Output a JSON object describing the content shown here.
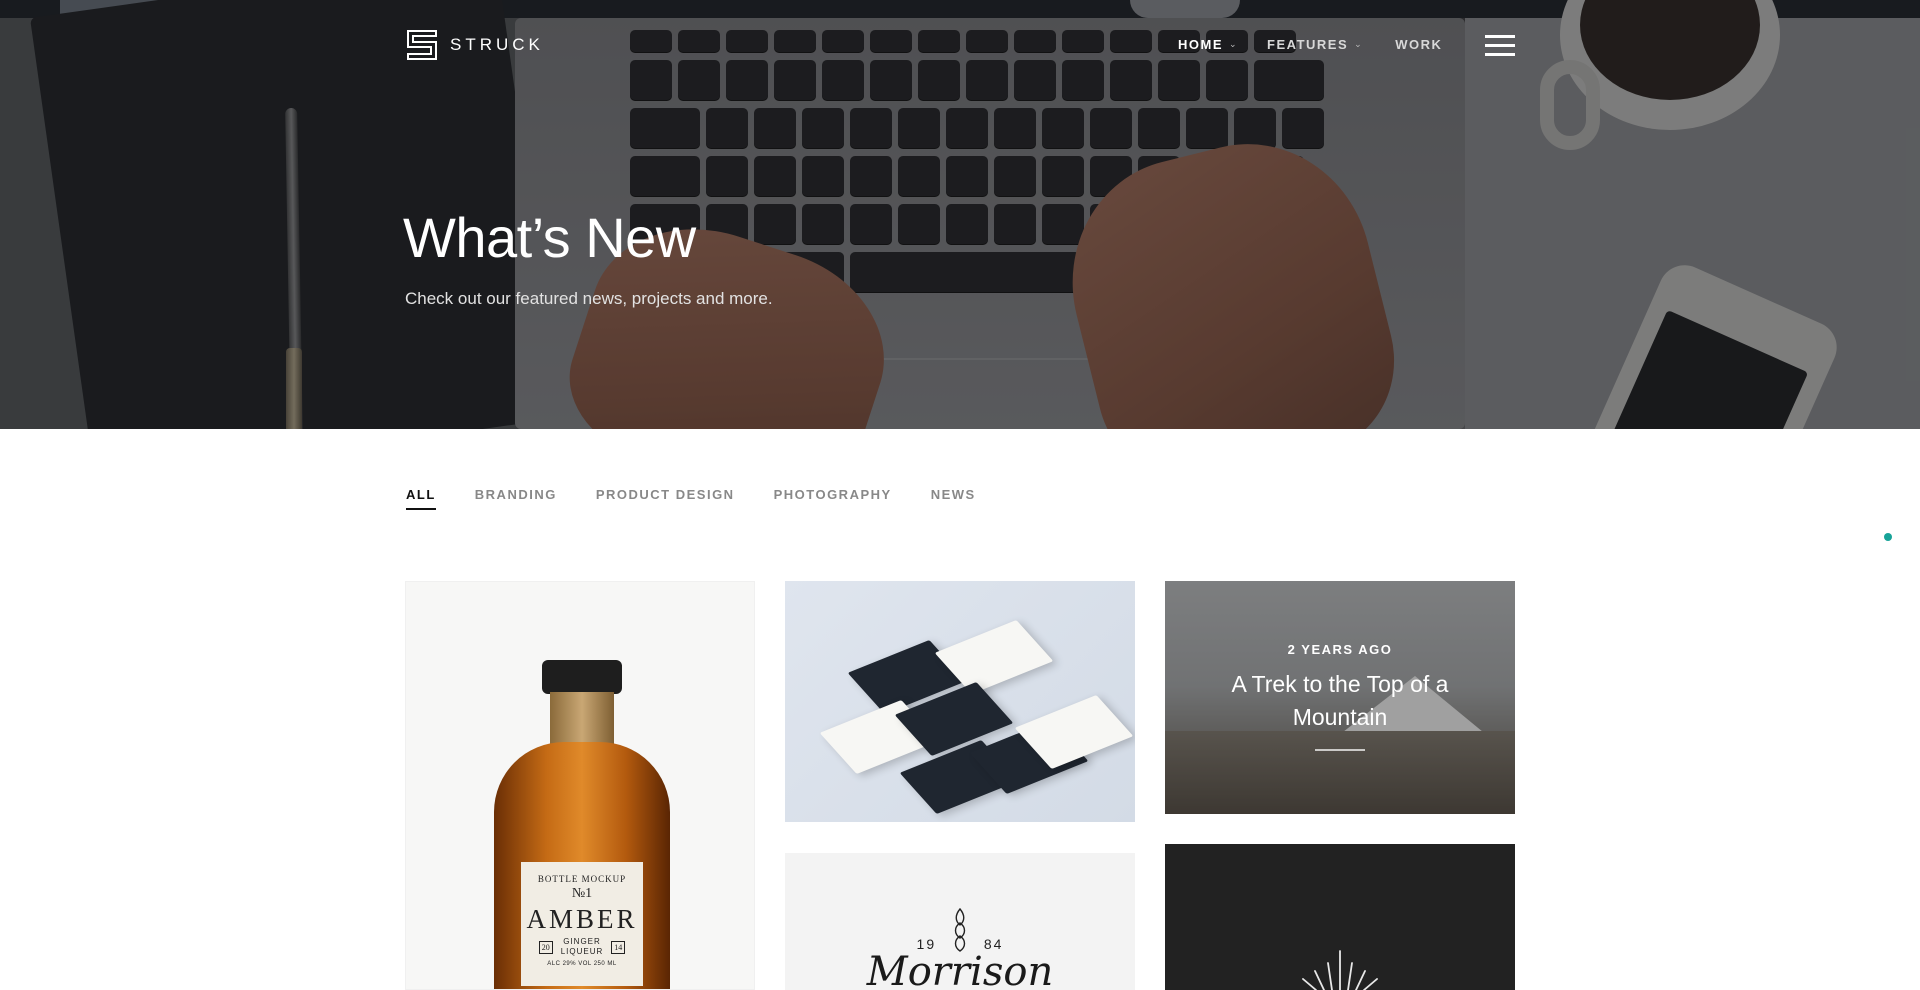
{
  "nav": {
    "logo_text": "STRUCK",
    "items": [
      {
        "label": "HOME",
        "has_dropdown": true
      },
      {
        "label": "FEATURES",
        "has_dropdown": true
      },
      {
        "label": "WORK",
        "has_dropdown": false
      }
    ],
    "menu_icon": "hamburger-icon"
  },
  "hero": {
    "title": "What’s New",
    "subtitle": "Check out our featured news, projects and more."
  },
  "filters": {
    "active": "ALL",
    "items": [
      "ALL",
      "BRANDING",
      "PRODUCT DESIGN",
      "PHOTOGRAPHY",
      "NEWS"
    ]
  },
  "cards": {
    "bottle": {
      "label_top": "BOTTLE MOCKUP",
      "label_no": "№1",
      "label_brand": "AMBER",
      "label_num_left": "20",
      "label_sub": "GINGER\nLIQUEUR",
      "label_num_right": "14",
      "label_foot": "ALC 29% VOL 250 ML"
    },
    "mountain": {
      "meta": "2 YEARS AGO",
      "title": "A Trek to the Top of a Mountain"
    },
    "morrison": {
      "year_left": "19",
      "year_right": "84",
      "word": "Morrison"
    }
  },
  "colors": {
    "accent_dot": "#17a398",
    "nav_text": "#ffffff",
    "filter_active": "#111111",
    "filter_inactive": "#888888"
  }
}
